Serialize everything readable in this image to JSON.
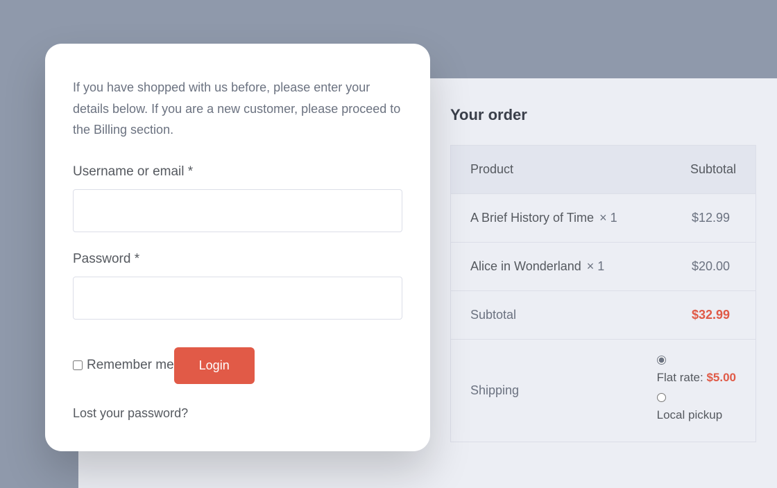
{
  "login": {
    "intro": "If you have shopped with us before, please enter your details below. If you are a new customer, please proceed to the Billing section.",
    "username_label": "Username or email ",
    "required_mark": "*",
    "password_label": "Password ",
    "remember_label": "Remember me",
    "button_label": "Login",
    "lost_password": "Lost your password?"
  },
  "order": {
    "title": "Your order",
    "header_product": "Product",
    "header_subtotal": "Subtotal",
    "items": [
      {
        "name": "A Brief History of Time",
        "qty": "× 1",
        "price": "$12.99"
      },
      {
        "name": "Alice in Wonderland",
        "qty": "× 1",
        "price": "$20.00"
      }
    ],
    "subtotal_label": "Subtotal",
    "subtotal_value": "$32.99",
    "shipping_label": "Shipping",
    "shipping_options": {
      "flat_label": "Flat rate: ",
      "flat_price": "$5.00",
      "pickup_label": "Local pickup"
    }
  }
}
